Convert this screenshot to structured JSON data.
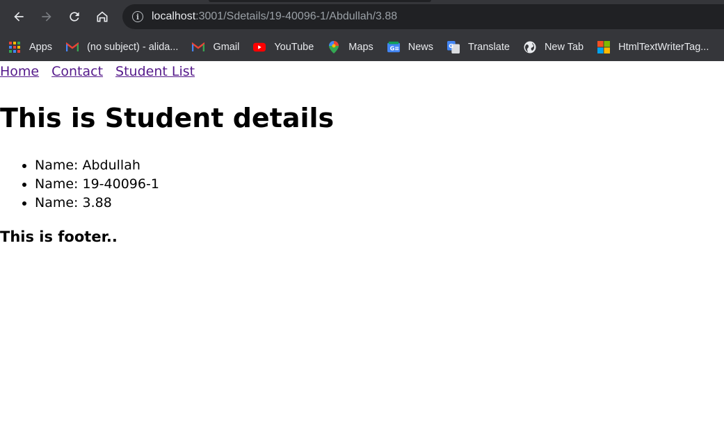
{
  "browser": {
    "url_host": "localhost",
    "url_path": ":3001/Sdetails/19-40096-1/Abdullah/3.88",
    "bookmarks": [
      {
        "label": "Apps",
        "icon": "apps-grid-icon"
      },
      {
        "label": "(no subject) - alida...",
        "icon": "gmail-icon"
      },
      {
        "label": "Gmail",
        "icon": "gmail-icon"
      },
      {
        "label": "YouTube",
        "icon": "youtube-icon"
      },
      {
        "label": "Maps",
        "icon": "maps-pin-icon"
      },
      {
        "label": "News",
        "icon": "google-news-icon"
      },
      {
        "label": "Translate",
        "icon": "google-translate-icon"
      },
      {
        "label": "New Tab",
        "icon": "globe-icon"
      },
      {
        "label": "HtmlTextWriterTag...",
        "icon": "microsoft-icon"
      }
    ]
  },
  "nav": {
    "links": [
      "Home",
      "Contact",
      "Student List"
    ]
  },
  "heading": "This is Student details",
  "details": [
    "Name: Abdullah",
    "Name: 19-40096-1",
    "Name: 3.88"
  ],
  "footer": "This is footer..",
  "colors": {
    "chrome_bg": "#35363a",
    "omnibox_bg": "#202124",
    "visited_link": "#551a8b"
  }
}
